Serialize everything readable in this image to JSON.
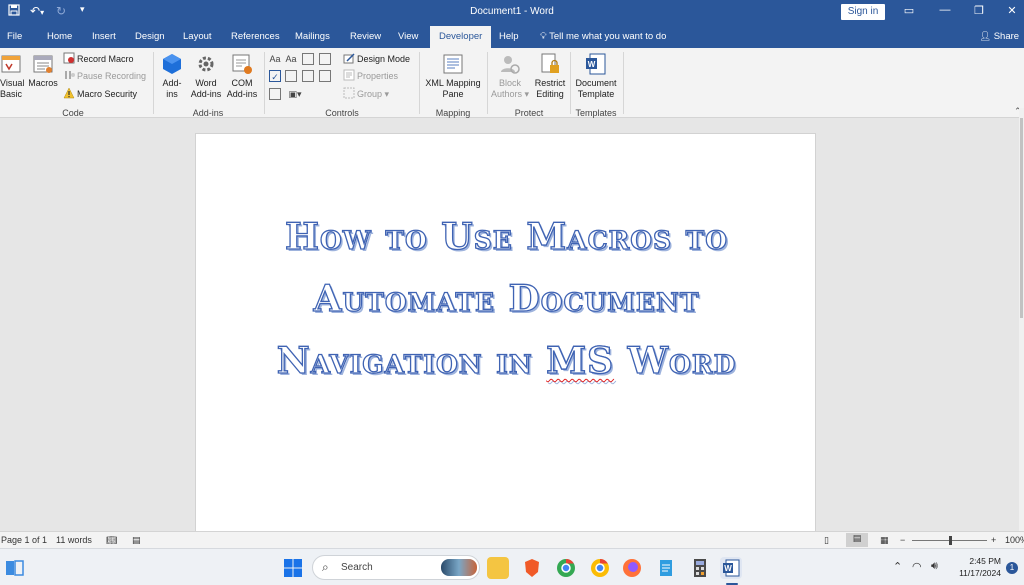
{
  "window": {
    "title": "Document1 - Word",
    "sign_in_label": "Sign in"
  },
  "tabs": [
    {
      "label": "File"
    },
    {
      "label": "Home"
    },
    {
      "label": "Insert"
    },
    {
      "label": "Design"
    },
    {
      "label": "Layout"
    },
    {
      "label": "References"
    },
    {
      "label": "Mailings"
    },
    {
      "label": "Review"
    },
    {
      "label": "View"
    },
    {
      "label": "Developer",
      "active": true
    },
    {
      "label": "Help"
    }
  ],
  "tell_me": "Tell me what you want to do",
  "share_label": "Share",
  "ribbon": {
    "code": {
      "label": "Code",
      "visual_basic": [
        "Visual",
        "Basic"
      ],
      "macros": "Macros",
      "record_macro": "Record Macro",
      "pause_recording": "Pause Recording",
      "macro_security": "Macro Security"
    },
    "addins": {
      "label": "Add-ins",
      "addins": [
        "Add-",
        "ins"
      ],
      "word_addins": [
        "Word",
        "Add-ins"
      ],
      "com_addins": [
        "COM",
        "Add-ins"
      ]
    },
    "controls": {
      "label": "Controls",
      "design_mode": "Design Mode",
      "properties": "Properties",
      "group": "Group"
    },
    "mapping": {
      "label": "Mapping",
      "xml_mapping_pane": [
        "XML Mapping",
        "Pane"
      ]
    },
    "protect": {
      "label": "Protect",
      "block_authors": [
        "Block",
        "Authors"
      ],
      "restrict_editing": [
        "Restrict",
        "Editing"
      ]
    },
    "templates": {
      "label": "Templates",
      "document_template": [
        "Document",
        "Template"
      ]
    }
  },
  "document": {
    "heading_lines": [
      "How to Use Macros to",
      "Automate Document",
      "Navigation in "
    ],
    "heading_misspelled": "MS",
    "heading_tail": " Word"
  },
  "status": {
    "page": "Page 1 of 1",
    "words": "11 words",
    "zoom": "100%"
  },
  "taskbar": {
    "search_placeholder": "Search",
    "time": "2:45 PM",
    "date": "11/17/2024",
    "notifications": "1"
  },
  "colors": {
    "word_blue": "#2b579a",
    "heading_outline": "#3f63b3",
    "heading_shadow": "#9eb3dd"
  }
}
